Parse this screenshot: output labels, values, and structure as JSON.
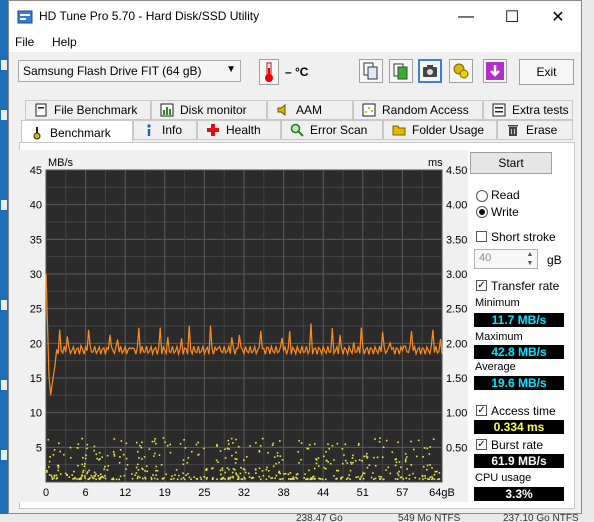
{
  "window": {
    "title": "HD Tune Pro 5.70 - Hard Disk/SSD Utility",
    "minimize": "—",
    "maximize": "☐",
    "close": "✕"
  },
  "menu": {
    "file": "File",
    "help": "Help"
  },
  "toolbar": {
    "drive": "Samsung Flash Drive FIT (64 gB)",
    "temperature": "– °C",
    "icons": [
      "copy-icon",
      "save-icon",
      "camera-icon",
      "options-icon",
      "download-icon"
    ],
    "exit": "Exit"
  },
  "tabs_top": [
    {
      "label": "File Benchmark",
      "icon": "file-benchmark-icon"
    },
    {
      "label": "Disk monitor",
      "icon": "disk-monitor-icon"
    },
    {
      "label": "AAM",
      "icon": "speaker-icon"
    },
    {
      "label": "Random Access",
      "icon": "random-access-icon"
    },
    {
      "label": "Extra tests",
      "icon": "extra-tests-icon"
    }
  ],
  "tabs_bottom": [
    {
      "label": "Benchmark",
      "icon": "benchmark-icon",
      "active": true
    },
    {
      "label": "Info",
      "icon": "info-icon"
    },
    {
      "label": "Health",
      "icon": "health-icon"
    },
    {
      "label": "Error Scan",
      "icon": "error-scan-icon"
    },
    {
      "label": "Folder Usage",
      "icon": "folder-icon"
    },
    {
      "label": "Erase",
      "icon": "trash-icon"
    }
  ],
  "chart_data": {
    "type": "line",
    "y_left_label": "MB/s",
    "y_right_label": "ms",
    "y_left_ticks": [
      "45",
      "40",
      "35",
      "30",
      "25",
      "20",
      "15",
      "10",
      "5"
    ],
    "y_right_ticks": [
      "4.50",
      "4.00",
      "3.50",
      "3.00",
      "2.50",
      "2.00",
      "1.50",
      "1.00",
      "0.50"
    ],
    "x_ticks": [
      "0",
      "6",
      "12",
      "19",
      "25",
      "32",
      "38",
      "44",
      "51",
      "57",
      "64gB"
    ],
    "y_left_range": [
      0,
      45
    ],
    "y_right_range": [
      0,
      4.5
    ],
    "x_range": [
      0,
      64
    ],
    "grid": true,
    "series": [
      {
        "kind": "transfer_rate_line",
        "color": "#ff8c1a",
        "min": 11.7,
        "max": 42.8,
        "average": 19.6
      },
      {
        "kind": "access_time_scatter",
        "color": "#e8e84a",
        "average_ms": 0.334
      }
    ]
  },
  "controls": {
    "start": "Start",
    "read": "Read",
    "write": "Write",
    "short_stroke": "Short stroke",
    "stroke_value": "40",
    "stroke_unit": "gB",
    "transfer_rate": "Transfer rate",
    "minimum_label": "Minimum",
    "minimum_value": "11.7 MB/s",
    "maximum_label": "Maximum",
    "maximum_value": "42.8 MB/s",
    "average_label": "Average",
    "average_value": "19.6 MB/s",
    "access_time": "Access time",
    "access_time_value": "0.334 ms",
    "burst_rate": "Burst rate",
    "burst_rate_value": "61.9 MB/s",
    "cpu_usage": "CPU usage",
    "cpu_usage_value": "3.3%"
  },
  "taskbar": [
    "238.47 Go",
    "549 Mo NTFS",
    "237.10 Go NTFS"
  ]
}
